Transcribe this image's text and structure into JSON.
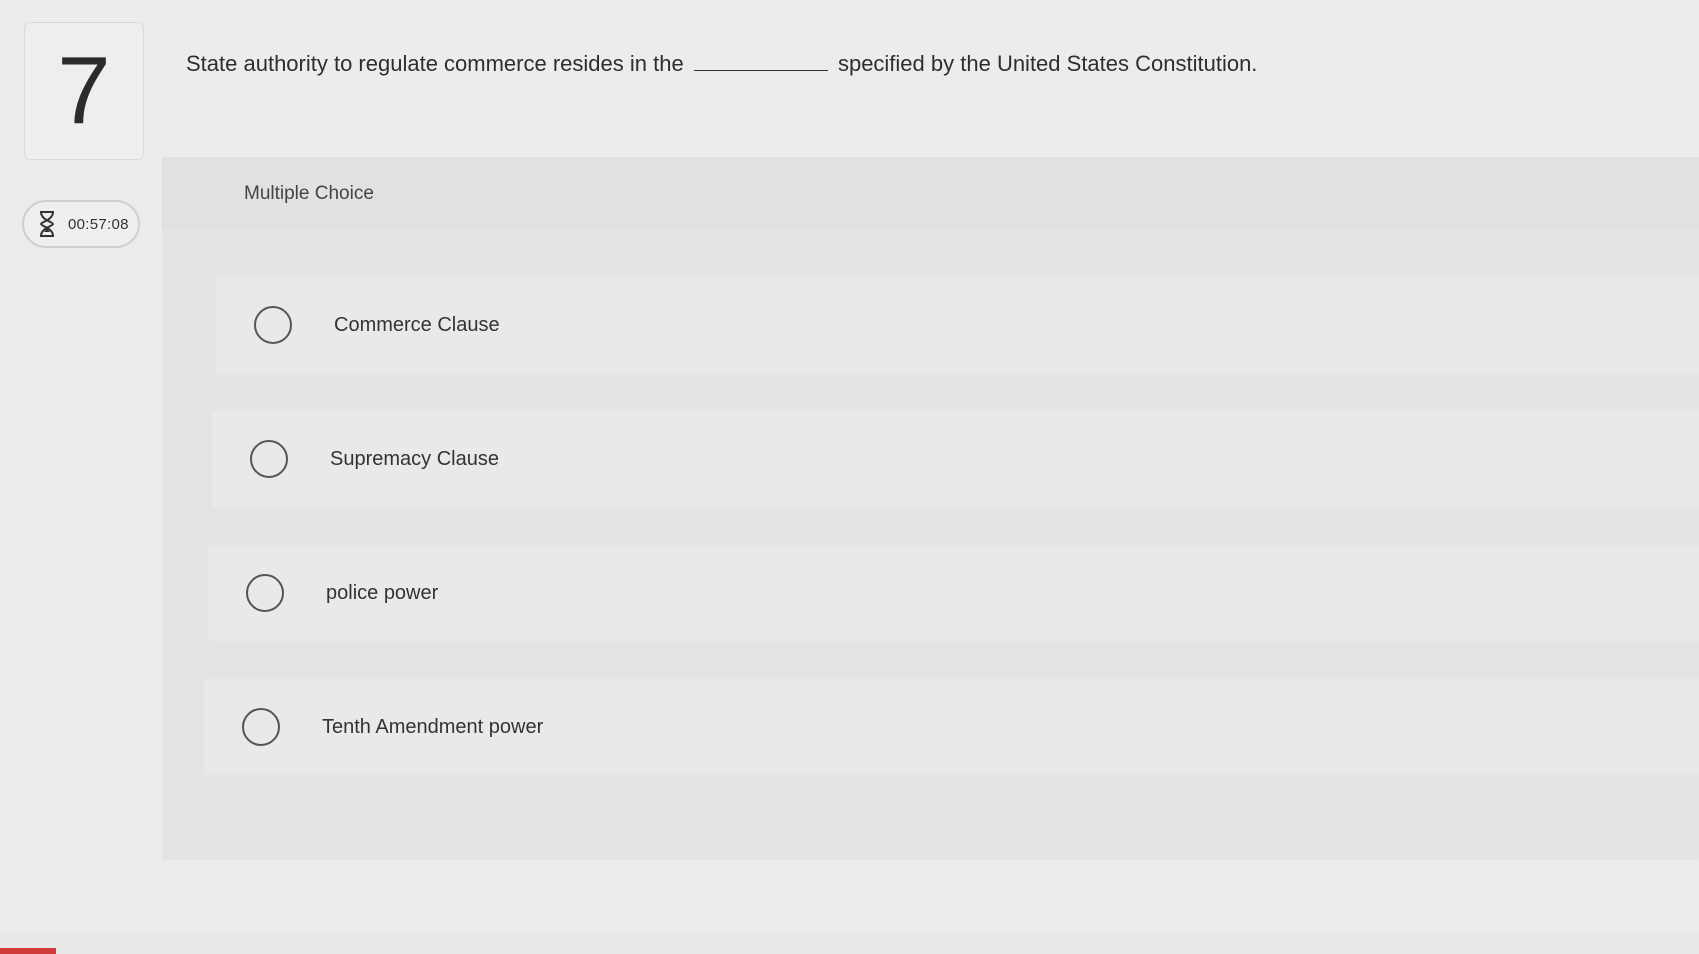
{
  "question": {
    "number": "7",
    "text_before": "State authority to regulate commerce resides in the",
    "text_after": "specified by the United States Constitution."
  },
  "timer": {
    "icon": "hourglass-icon",
    "value": "00:57:08"
  },
  "answer_area": {
    "type_label": "Multiple Choice",
    "options": [
      {
        "label": "Commerce Clause",
        "selected": false
      },
      {
        "label": "Supremacy Clause",
        "selected": false
      },
      {
        "label": "police power",
        "selected": false
      },
      {
        "label": "Tenth Amendment power",
        "selected": false
      }
    ]
  },
  "colors": {
    "page_bg": "#ececec",
    "panel_bg": "#e4e4e4",
    "option_bg": "#e9e9e9",
    "accent_red": "#d13a3a"
  }
}
